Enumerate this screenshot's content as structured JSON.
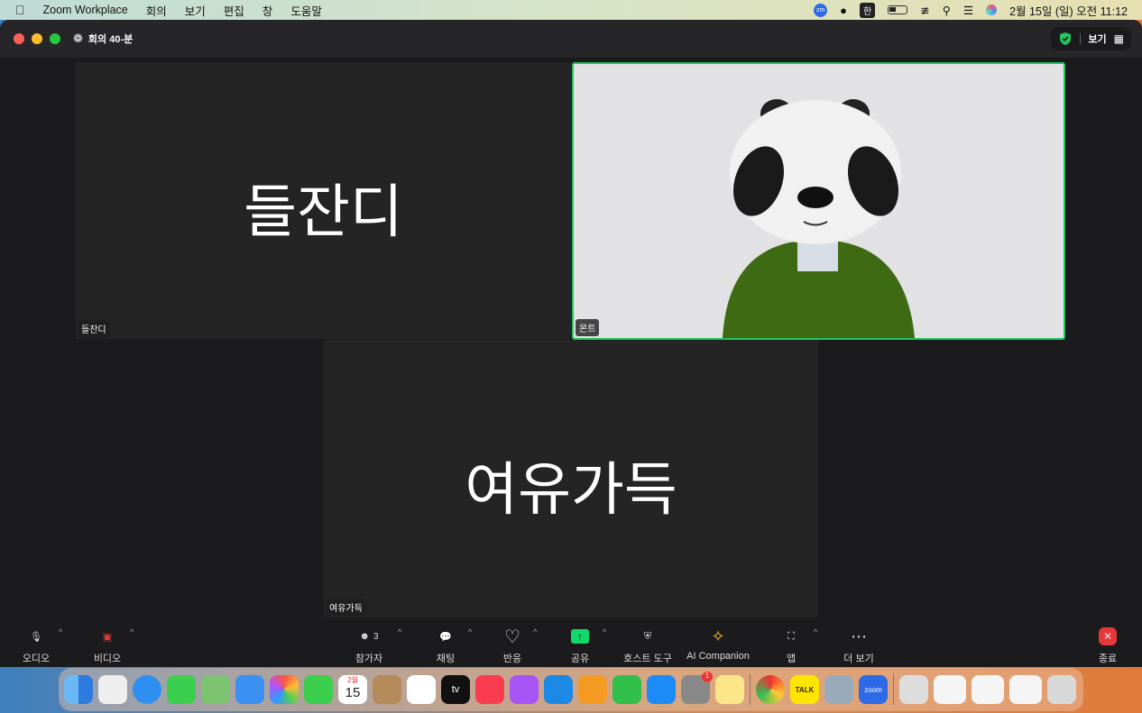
{
  "menubar": {
    "app": "Zoom Workplace",
    "items": [
      "회의",
      "보기",
      "편집",
      "창",
      "도움말"
    ],
    "ime": "한",
    "clock": "2월 15일 (일) 오전 11:12",
    "zoom_badge": "zm"
  },
  "window": {
    "meeting_title": "회의 40-분",
    "view_label": "보기"
  },
  "participants": [
    {
      "name": "들잔디",
      "big": "들잔디"
    },
    {
      "name": "몬트"
    },
    {
      "name": "여유가득",
      "big": "여유가득"
    }
  ],
  "toolbar": {
    "audio": "오디오",
    "video": "비디오",
    "participants": "참가자",
    "participant_count": "3",
    "chat": "채팅",
    "reactions": "반응",
    "share": "공유",
    "host_tools": "호스트 도구",
    "ai": "AI Companion",
    "apps": "앱",
    "more": "더 보기",
    "end": "종료"
  },
  "dock": {
    "calendar_month": "2월",
    "calendar_day": "15",
    "music_badge": "1",
    "kakao": "TALK",
    "zoom": "zoom",
    "appletv": "tv"
  },
  "colors": {
    "accent_green": "#22c55e",
    "share_green": "#11d86b",
    "end_red": "#e5383b"
  }
}
